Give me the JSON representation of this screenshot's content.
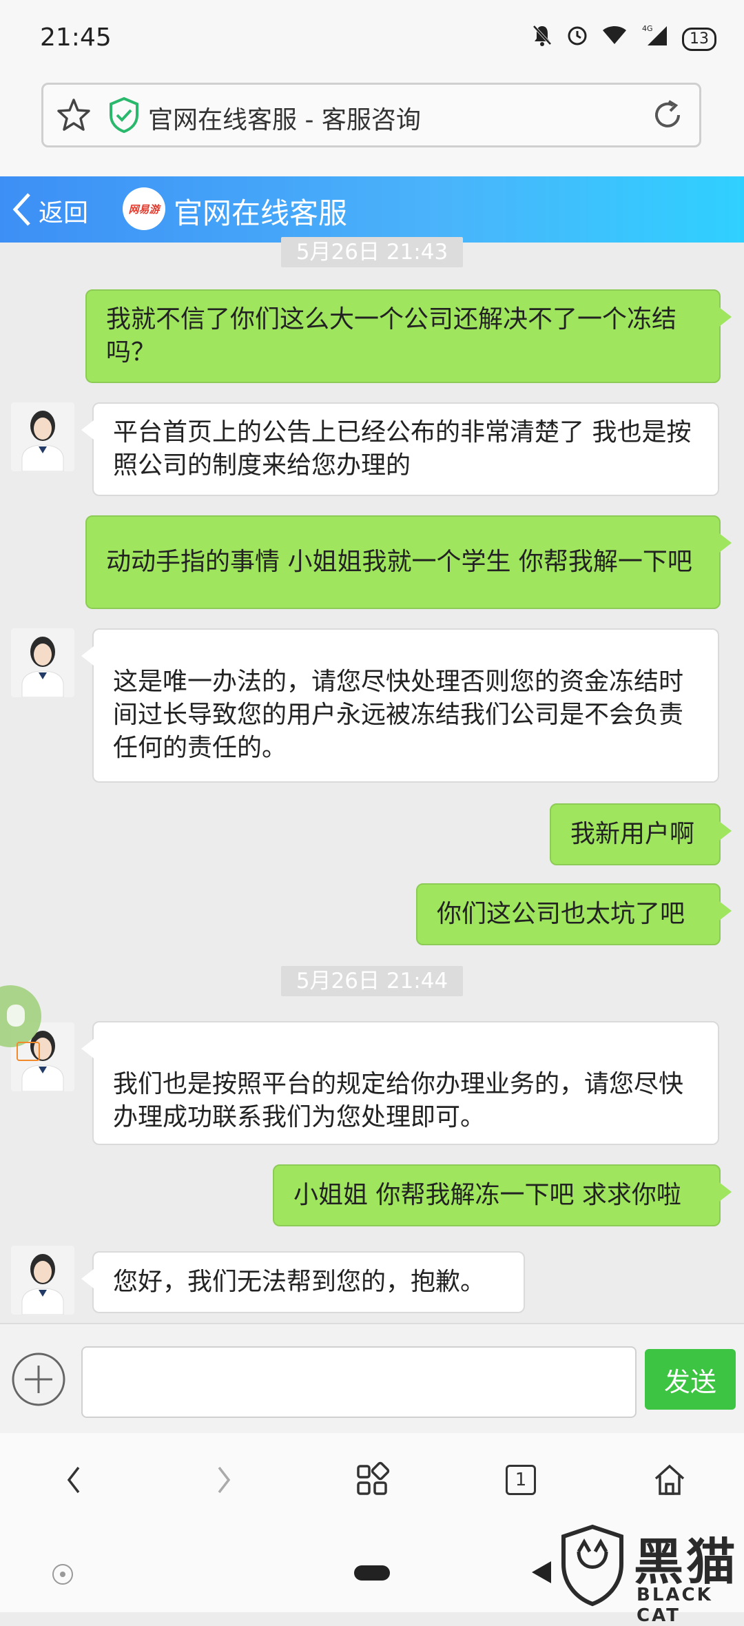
{
  "status_bar": {
    "time": "21:45",
    "battery": "13"
  },
  "browser": {
    "page_title": "官网在线客服 - 客服咨询"
  },
  "header": {
    "back_label": "返回",
    "logo_text": "网易游",
    "title": "官网在线客服"
  },
  "messages": [
    {
      "type": "time",
      "text": "5月26日 21:43"
    },
    {
      "type": "out",
      "text": "我就不信了你们这么大一个公司还解决不了一个冻结吗？"
    },
    {
      "type": "in",
      "text": "平台首页上的公告上已经公布的非常清楚了 我也是按照公司的制度来给您办理的"
    },
    {
      "type": "out",
      "text": "动动手指的事情 小姐姐我就一个学生 你帮我解一下吧"
    },
    {
      "type": "in",
      "text": " 这是唯一办法的，请您尽快处理否则您的资金冻结时间过长导致您的用户永远被冻结我们公司是不会负责任何的责任的。"
    },
    {
      "type": "out",
      "text": "我新用户啊"
    },
    {
      "type": "out",
      "text": "你们这公司也太坑了吧"
    },
    {
      "type": "time",
      "text": "5月26日 21:44"
    },
    {
      "type": "in",
      "text": "我们也是按照平台的规定给你办理业务的，请您尽快办理成功联系我们为您处理即可。"
    },
    {
      "type": "out",
      "text": "小姐姐 你帮我解冻一下吧 求求你啦"
    },
    {
      "type": "in",
      "text": "您好，我们无法帮到您的，抱歉。"
    }
  ],
  "input": {
    "value": "",
    "placeholder": ""
  },
  "send_label": "发送",
  "toolbar": {
    "tab_count": "1"
  },
  "watermark": {
    "text": "黑猫",
    "sub": "BLACK CAT"
  },
  "colors": {
    "accent": "#3d8ff5",
    "bubble_out": "#9fe65e",
    "send": "#3cc442"
  }
}
